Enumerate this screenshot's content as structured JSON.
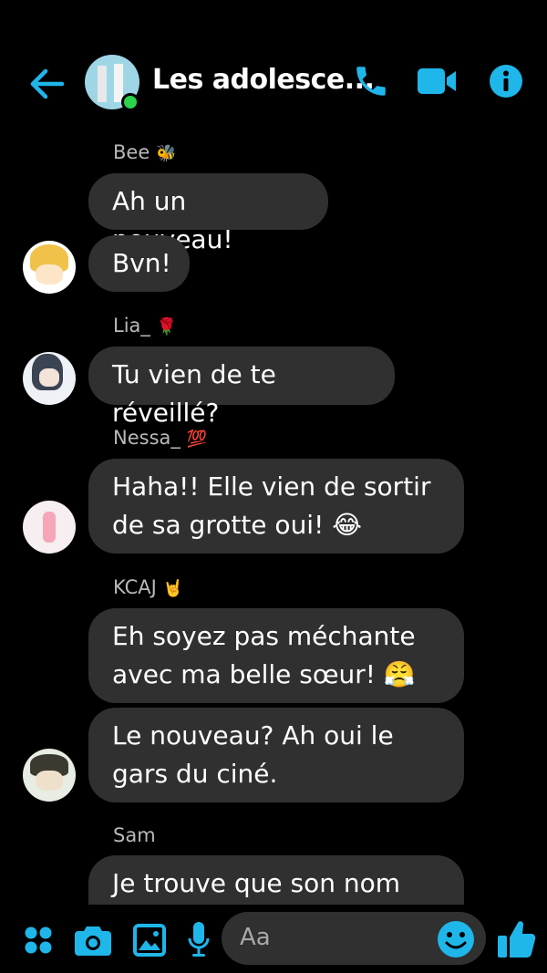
{
  "header": {
    "title": "Les adolesce...",
    "back_icon": "arrow-left-icon",
    "call_icon": "phone-icon",
    "video_icon": "video-camera-icon",
    "info_icon": "info-icon",
    "accent": "#1fb6ea"
  },
  "messages": [
    {
      "sender": "Bee",
      "emoji": "🐝",
      "bubbles": [
        "Ah un nouveau!",
        "Bvn!"
      ]
    },
    {
      "sender": "Lia_",
      "emoji": "🌹",
      "bubbles": [
        "Tu vien de te réveillé?"
      ]
    },
    {
      "sender": "Nessa_",
      "emoji": "💯",
      "bubbles": [
        "Haha!! Elle vien de sortir de sa grotte oui! 😂"
      ]
    },
    {
      "sender": "KCAJ",
      "emoji": "🤘",
      "bubbles": [
        "Eh soyez pas méchante avec ma belle sœur! 😤",
        "Le nouveau? Ah oui le gars du ciné."
      ]
    },
    {
      "sender": "Sam",
      "emoji": "",
      "bubbles": [
        "Je trouve que son nom"
      ]
    }
  ],
  "composer": {
    "placeholder": "Aa",
    "icons": [
      "grid-icon",
      "camera-icon",
      "image-icon",
      "microphone-icon",
      "emoji-icon",
      "thumbs-up-icon"
    ]
  }
}
